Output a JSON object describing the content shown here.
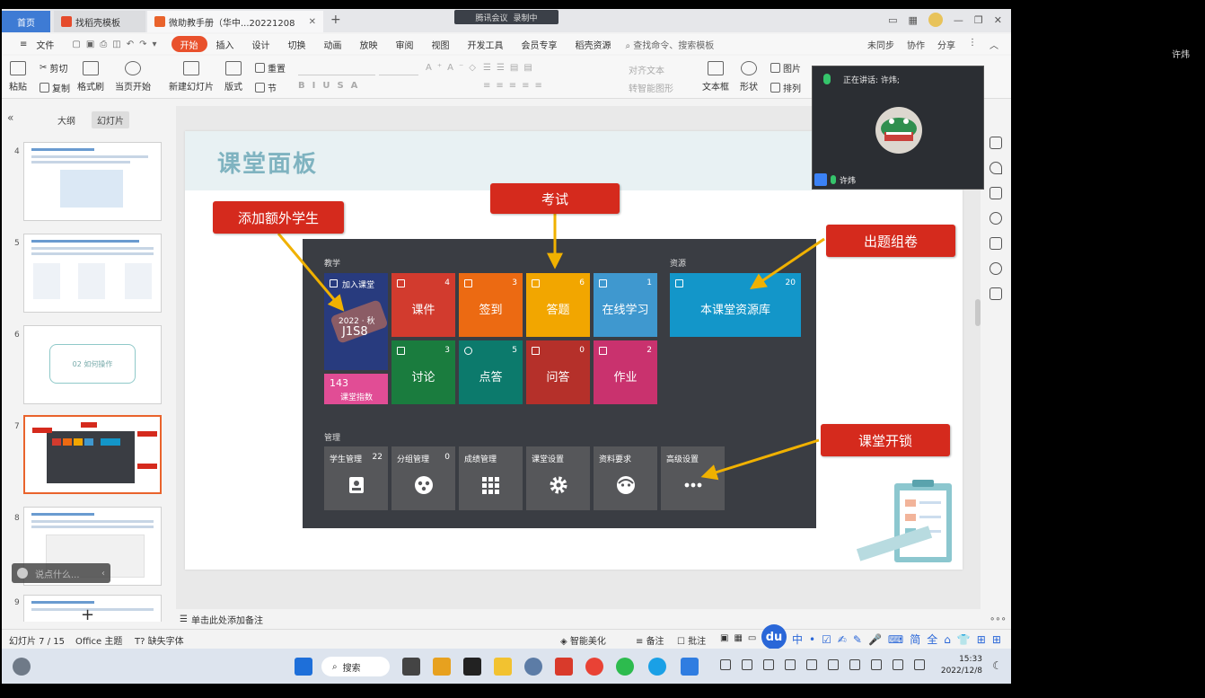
{
  "titlebar": {
    "tabs": [
      {
        "label": "首页"
      },
      {
        "label": "找稻壳模板"
      },
      {
        "label": "微助教手册（华中...20221208"
      }
    ],
    "meeting": {
      "app": "腾讯会议",
      "recording": "录制中"
    }
  },
  "menubar": {
    "file": "文件",
    "start": "开始",
    "items": [
      "插入",
      "设计",
      "切换",
      "动画",
      "放映",
      "审阅",
      "视图",
      "开发工具",
      "会员专享",
      "稻壳资源"
    ],
    "search": "查找命令、搜索模板",
    "sync": "未同步",
    "collab": "协作",
    "share": "分享"
  },
  "ribbon": {
    "paste": "粘贴",
    "cut": "剪切",
    "copy": "复制",
    "format_painter": "格式刷",
    "play_from_current": "当页开始",
    "new_slide": "新建幻灯片",
    "layout": "版式",
    "section": "节",
    "reset": "重置",
    "align_text": "对齐文本",
    "convert_smart": "转智能图形",
    "textbox": "文本框",
    "shape": "形状",
    "picture": "图片",
    "arrange": "排列"
  },
  "video": {
    "speaking": "正在讲话: 许炜;",
    "name": "许炜"
  },
  "outside_name": "许炜",
  "leftpanel": {
    "tab_outline": "大纲",
    "tab_slides": "幻灯片",
    "thumb_nums": [
      "4",
      "5",
      "6",
      "7",
      "8",
      "9"
    ],
    "thumb6_text": "02 如何操作",
    "chat_placeholder": "说点什么..."
  },
  "slide": {
    "title": "课堂面板",
    "callouts": {
      "add_student": "添加额外学生",
      "exam": "考试",
      "question_bank": "出题组卷",
      "unlock": "课堂开锁"
    },
    "dashboard": {
      "section_teach": "教学",
      "section_resource": "资源",
      "section_manage": "管理",
      "join_tile": {
        "label": "加入课堂",
        "term": "2022 · 秋",
        "code": "J1S8"
      },
      "index_tile": {
        "value": "143",
        "label": "课堂指数"
      },
      "tiles": [
        {
          "label": "课件",
          "count": "4",
          "color": "#d23b2e"
        },
        {
          "label": "签到",
          "count": "3",
          "color": "#ec6a12"
        },
        {
          "label": "答题",
          "count": "6",
          "color": "#f2a600"
        },
        {
          "label": "在线学习",
          "count": "1",
          "color": "#3f98cf"
        },
        {
          "label": "讨论",
          "count": "3",
          "color": "#1a7c3e"
        },
        {
          "label": "点答",
          "count": "5",
          "color": "#0c7a6c"
        },
        {
          "label": "问答",
          "count": "0",
          "color": "#b5302a"
        },
        {
          "label": "作业",
          "count": "2",
          "color": "#c9326e"
        }
      ],
      "resource_tile": {
        "label": "本课堂资源库",
        "count": "20",
        "color": "#1396c9"
      },
      "manage_tiles": [
        {
          "label": "学生管理",
          "count": "22",
          "icon": "contact-icon"
        },
        {
          "label": "分组管理",
          "count": "0",
          "icon": "group-icon"
        },
        {
          "label": "成绩管理",
          "count": "",
          "icon": "grid-icon"
        },
        {
          "label": "课堂设置",
          "count": "",
          "icon": "gear-icon"
        },
        {
          "label": "资料要求",
          "count": "",
          "icon": "face-icon"
        },
        {
          "label": "高级设置",
          "count": "",
          "icon": "more-icon"
        }
      ]
    }
  },
  "notes": {
    "placeholder": "单击此处添加备注"
  },
  "statusbar": {
    "slide_count": "幻灯片 7 / 15",
    "theme": "Office 主题",
    "missing_font": "缺失字体",
    "beautify": "智能美化",
    "notes": "备注",
    "comments": "批注"
  },
  "taskbar": {
    "search": "搜索",
    "time": "15:33",
    "date": "2022/12/8",
    "ime": "中"
  }
}
